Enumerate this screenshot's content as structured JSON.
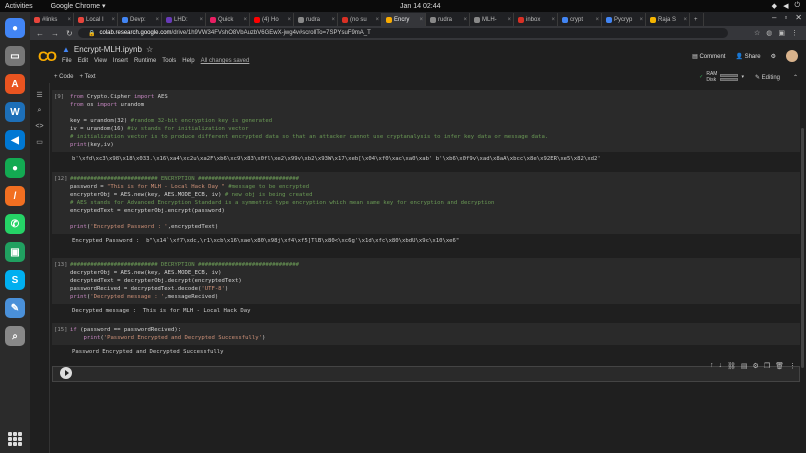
{
  "system": {
    "activities": "Activities",
    "app_name": "Google Chrome ▾",
    "clock": "Jan 14  02:44"
  },
  "browser": {
    "tabs": [
      {
        "label": "#links",
        "color": "#e8453c"
      },
      {
        "label": "Local I",
        "color": "#e8453c"
      },
      {
        "label": "Devp:",
        "color": "#4285f4"
      },
      {
        "label": "LHD:",
        "color": "#673ab7"
      },
      {
        "label": "Quick",
        "color": "#e91e63"
      },
      {
        "label": "(4) Ho",
        "color": "#ff0000"
      },
      {
        "label": "rudra",
        "color": "#888888"
      },
      {
        "label": "(no su",
        "color": "#d93025"
      },
      {
        "label": "Encry",
        "color": "#f9ab00",
        "active": true
      },
      {
        "label": "rudra",
        "color": "#888888"
      },
      {
        "label": "MLH-",
        "color": "#888888"
      },
      {
        "label": "inbox",
        "color": "#d93025"
      },
      {
        "label": "crypt",
        "color": "#4285f4"
      },
      {
        "label": "Pycryp",
        "color": "#4285f4"
      },
      {
        "label": "Raja S",
        "color": "#f4b400"
      }
    ],
    "url_host": "colab.research.google.com",
    "url_path": "/drive/1h9VW34FVshO8VbAuzbV6GEwX-jwg4v#scrollTo=7SPYsuF9mA_T"
  },
  "notebook": {
    "logo": "CO",
    "title": "Encrypt-MLH.ipynb",
    "menu": [
      "File",
      "Edit",
      "View",
      "Insert",
      "Runtime",
      "Tools",
      "Help"
    ],
    "saved_status": "All changes saved",
    "comment": "Comment",
    "share": "Share",
    "add_code": "+ Code",
    "add_text": "+ Text",
    "ram": "RAM",
    "disk": "Disk",
    "editing": "Editing"
  },
  "cells": [
    {
      "prompt": "[9]",
      "lines": [
        "from Crypto.Cipher import AES",
        "from os import urandom",
        "",
        "key = urandom(32) #random 32-bit encryption key is generated",
        "iv = urandom(16) #iv stands for initialization vector",
        "# initialization vector is to produce different encrypted data so that an attacker cannot use cryptanalysis to infer key data or message data.",
        "print(key,iv)"
      ],
      "output": "b'\\xfd\\xc3\\x98\\x18\\x033.\\x16\\xa4\\xc2u\\xa2F\\xb6\\xc9\\x83\\x0fl\\xe2\\x99v\\xb2\\x93W\\x17\\xeb[\\x04\\xf0\\xac\\xa0\\xab' b'\\xb6\\x0f9v\\xad\\x8aA\\xbcc\\x8e\\x92ER\\xe5\\x82\\xd2'"
    },
    {
      "prompt": "[12]",
      "lines": [
        "########################## ENCRYPTION ##############################",
        "password = \"This is for MLH - Local Hack Day \" #message to be encrypted",
        "encrypterObj = AES.new(key, AES.MODE_ECB, iv) # new obj is being created",
        "# AES stands for Advanced Encryption Standard is a symmetric type encryption which mean same key for encryption and decryption",
        "encryptedText = encrypterObj.encrypt(password)",
        "",
        "print('Encrypted Password : ',encryptedText)"
      ],
      "output": "Encrypted Password :  b\"\\x14`\\xf7\\xdc,\\r1\\xcb\\x16\\xae\\x80\\x98j\\xf4\\xf5]TlB\\x80<\\xc6g'\\x1d\\xfc\\x80\\xbdU\\x9c\\x10\\xe6\""
    },
    {
      "prompt": "[13]",
      "lines": [
        "########################## DECRYPTION ##############################",
        "decrypterObj = AES.new(key, AES.MODE_ECB, iv)",
        "decryptedText = decrypterObj.decrypt(encryptedText)",
        "passwordRecived = decryptedText.decode('UTF-8')",
        "print('Decrypted message : ',messageRecived)"
      ],
      "output": "Decrypted message :  This is for MLH - Local Hack Day"
    },
    {
      "prompt": "[15]",
      "lines": [
        "if (password == passwordRecived):",
        "    print('Password Encrypted and Decrypted Successfully')"
      ],
      "output": "Password Encrypted and Decrypted Successfully"
    }
  ]
}
